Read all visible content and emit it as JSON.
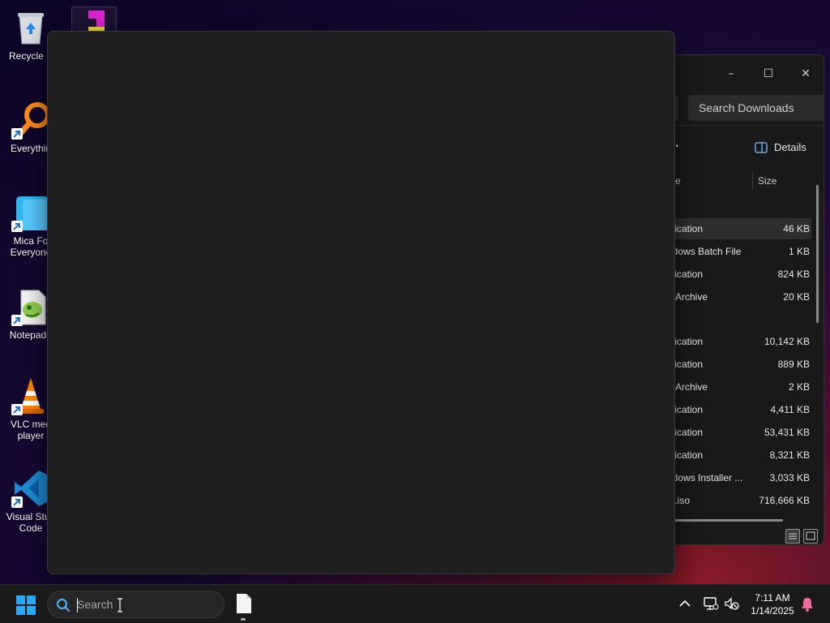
{
  "desktop": {
    "icons": [
      {
        "label": "Recycle B",
        "icon": "recycle-bin-icon"
      },
      {
        "label": "Everythin",
        "icon": "everything-search-icon"
      },
      {
        "label_line1": "Mica Fo",
        "label_line2": "Everyone",
        "icon": "folder-icon"
      },
      {
        "label": "Notepad+",
        "icon": "notepad-plus-plus-icon"
      },
      {
        "label_line1": "VLC med",
        "label_line2": "player",
        "icon": "vlc-cone-icon"
      },
      {
        "label_line1": "Visual Stud",
        "label_line2": "Code",
        "icon": "vscode-icon"
      }
    ],
    "top_icon": "tetris-app-icon"
  },
  "explorer": {
    "controls": {
      "minimize": "–",
      "maximize": "☐",
      "close": "✕"
    },
    "search_placeholder": "Search Downloads",
    "toolbar_more": "·",
    "details_label": "Details",
    "columns": {
      "type_partial": "e",
      "size": "Size"
    },
    "rows": [
      {
        "type": "plication",
        "size": "46 KB",
        "selected": true
      },
      {
        "type": "ndows Batch File",
        "size": "1 KB"
      },
      {
        "type": "plication",
        "size": "824 KB"
      },
      {
        "type": "Archive",
        "size": "20 KB"
      },
      {
        "type": "plication",
        "size": "10,142 KB"
      },
      {
        "type": "plication",
        "size": "889 KB"
      },
      {
        "type": "Archive",
        "size": "2 KB"
      },
      {
        "type": "plication",
        "size": "4,411 KB"
      },
      {
        "type": "plication",
        "size": "53,431 KB"
      },
      {
        "type": "plication",
        "size": "8,321 KB"
      },
      {
        "type": "ndows Installer ...",
        "size": "3,033 KB"
      },
      {
        "type": "ip.iso",
        "size": "716,666 KB"
      }
    ]
  },
  "taskbar": {
    "search_placeholder": "Search",
    "time": "7:11 AM",
    "date": "1/14/2025"
  },
  "colors": {
    "accent": "#0078d4",
    "panel": "#202020",
    "taskbar": "#1a1a1a"
  }
}
